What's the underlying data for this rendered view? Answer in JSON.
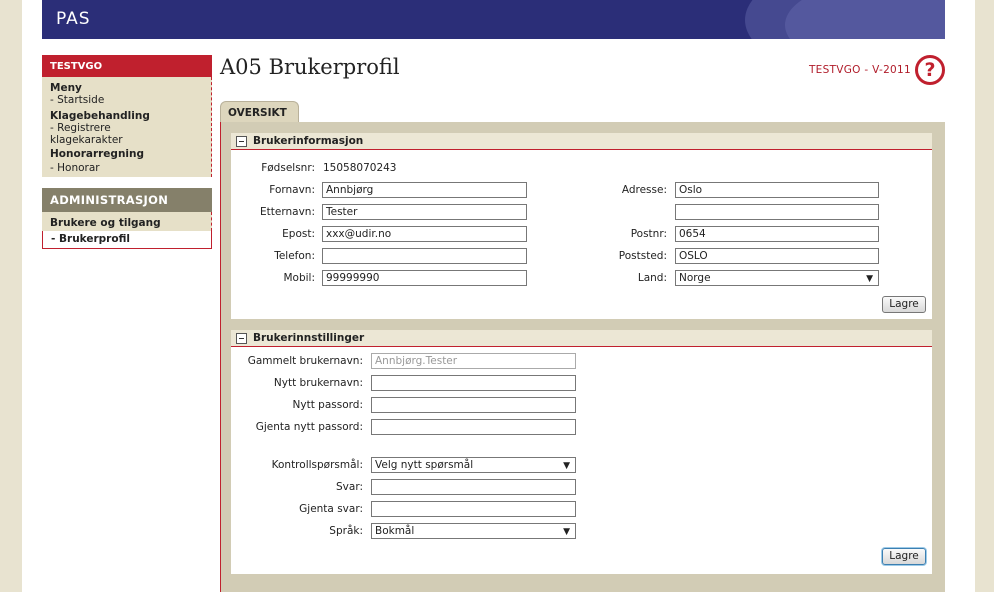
{
  "app": {
    "banner_title": "PAS"
  },
  "sidebar": {
    "header": "TESTVGO",
    "menu_title": "Meny",
    "startside": "- Startside",
    "klage_title": "Klagebehandling",
    "registrere": "- Registrere klagekarakter",
    "honorar_title": "Honorarregning",
    "honorar": "- Honorar",
    "admin_header": "ADMINISTRASJON",
    "brukere": "Brukere og tilgang",
    "brukerprofil": "- Brukerprofil"
  },
  "header": {
    "title": "A05 Brukerprofil",
    "system": "TESTVGO - V-2011",
    "help_symbol": "?"
  },
  "tabs": {
    "oversikt": "OVERSIKT"
  },
  "brukerinformasjon": {
    "title": "Brukerinformasjon",
    "fodselsnr_label": "Fødselsnr:",
    "fodselsnr": "15058070243",
    "fornavn_label": "Fornavn:",
    "fornavn": "Annbjørg",
    "etternavn_label": "Etternavn:",
    "etternavn": "Tester",
    "epost_label": "Epost:",
    "epost": "xxx@udir.no",
    "telefon_label": "Telefon:",
    "telefon": "",
    "mobil_label": "Mobil:",
    "mobil": "99999990",
    "adresse_label": "Adresse:",
    "adresse": "Oslo",
    "adresse2": "",
    "postnr_label": "Postnr:",
    "postnr": "0654",
    "poststed_label": "Poststed:",
    "poststed": "OSLO",
    "land_label": "Land:",
    "land": "Norge",
    "save": "Lagre"
  },
  "brukerinnstillinger": {
    "title": "Brukerinnstillinger",
    "gammelt_label": "Gammelt brukernavn:",
    "gammelt": "Annbjørg.Tester",
    "nytt_label": "Nytt brukernavn:",
    "passord_label": "Nytt passord:",
    "gjenta_passord_label": "Gjenta nytt passord:",
    "kontroll_label": "Kontrollspørsmål:",
    "kontroll": "Velg nytt spørsmål",
    "svar_label": "Svar:",
    "gjenta_svar_label": "Gjenta svar:",
    "sprak_label": "Språk:",
    "sprak": "Bokmål",
    "save": "Lagre"
  }
}
